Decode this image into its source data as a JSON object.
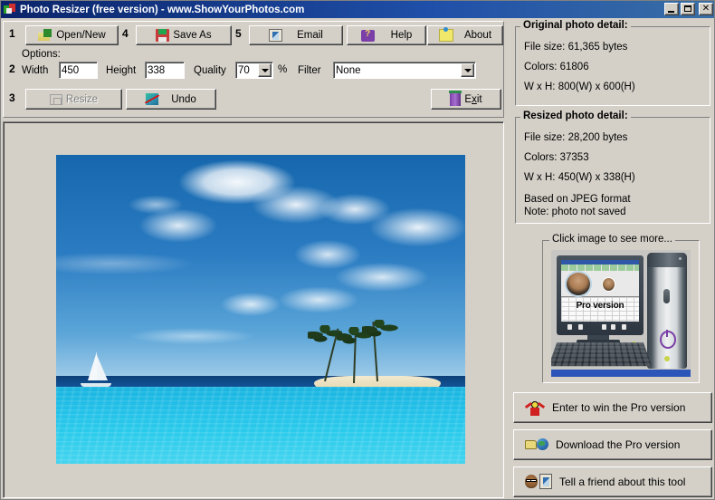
{
  "window": {
    "title": "Photo Resizer (free version)  - www.ShowYourPhotos.com",
    "icon": "app-icon",
    "minimize_label": "_",
    "maximize_label": "□",
    "close_label": "✕"
  },
  "toolbar": {
    "step1": "1",
    "step2": "2",
    "step3": "3",
    "step4": "4",
    "step5": "5",
    "open_label": "Open/New",
    "save_label": "Save As",
    "email_label": "Email",
    "help_label": "Help",
    "about_label": "About",
    "resize_label": "Resize",
    "undo_label": "Undo",
    "exit_label": "Exit",
    "exit_mnemonic_prefix": "E",
    "exit_mnemonic_letter": "x",
    "exit_mnemonic_suffix": "it",
    "resize_enabled": false
  },
  "options": {
    "section_label": "Options:",
    "width_label": "Width",
    "width_value": "450",
    "height_label": "Height",
    "height_value": "338",
    "quality_label": "Quality",
    "quality_value": "70",
    "percent_label": "%",
    "filter_label": "Filter",
    "filter_value": "None",
    "filter_options": [
      "None"
    ],
    "quality_options": [
      "70"
    ]
  },
  "original_detail": {
    "legend": "Original photo detail:",
    "file_size": "File size: 61,365 bytes",
    "colors": "Colors: 61806",
    "dimensions": "W x H: 800(W) x 600(H)"
  },
  "resized_detail": {
    "legend": "Resized photo detail:",
    "file_size": "File size: 28,200 bytes",
    "colors": "Colors: 37353",
    "dimensions": "W x H: 450(W) x 338(H)",
    "format": "Based on JPEG format",
    "note": "Note: photo not saved"
  },
  "promo": {
    "legend": "Click image to see more...",
    "image_caption": "Pro version",
    "enter_label": "Enter to win the Pro version",
    "download_label": "Download the Pro version",
    "tell_label": "Tell a friend about this tool"
  },
  "photo": {
    "alt": "Tropical island with palm trees, sailboat and turquoise sea"
  },
  "colors": {
    "titlebar_start": "#0a246a",
    "titlebar_end": "#3a6ea5",
    "face": "#d4d0c8",
    "shadow": "#808080",
    "highlight": "#ffffff",
    "text": "#000000",
    "disabled_text": "#808080"
  }
}
